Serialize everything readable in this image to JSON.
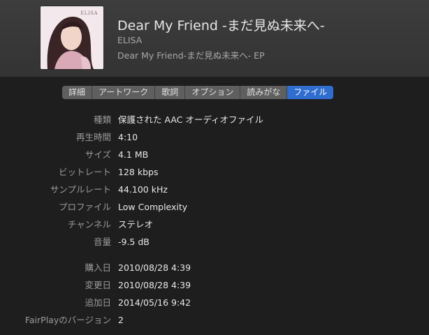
{
  "header": {
    "artwork": {
      "icon": "album-artwork-icon",
      "text": "ELISA"
    },
    "title": "Dear My Friend -まだ見ぬ未来へ-",
    "artist": "ELISA",
    "album": "Dear My Friend-まだ見ぬ未来へ- EP"
  },
  "tabs": [
    {
      "label": "詳細",
      "active": false
    },
    {
      "label": "アートワーク",
      "active": false
    },
    {
      "label": "歌詞",
      "active": false
    },
    {
      "label": "オプション",
      "active": false
    },
    {
      "label": "読みがな",
      "active": false
    },
    {
      "label": "ファイル",
      "active": true
    }
  ],
  "file_info": [
    {
      "label": "種類",
      "value": "保護された AAC オーディオファイル"
    },
    {
      "label": "再生時間",
      "value": "4:10"
    },
    {
      "label": "サイズ",
      "value": "4.1 MB"
    },
    {
      "label": "ビットレート",
      "value": "128 kbps"
    },
    {
      "label": "サンプルレート",
      "value": "44.100 kHz"
    },
    {
      "label": "プロファイル",
      "value": "Low Complexity"
    },
    {
      "label": "チャンネル",
      "value": "ステレオ"
    },
    {
      "label": "音量",
      "value": "-9.5 dB"
    }
  ],
  "dates": [
    {
      "label": "購入日",
      "value": "2010/08/28 4:39"
    },
    {
      "label": "変更日",
      "value": "2010/08/28 4:39"
    },
    {
      "label": "追加日",
      "value": "2014/05/16 9:42"
    },
    {
      "label": "FairPlayのバージョン",
      "value": "2"
    }
  ],
  "colors": {
    "accent": "#2f6dd1",
    "background": "#1e1e1e",
    "header": "#383838"
  }
}
